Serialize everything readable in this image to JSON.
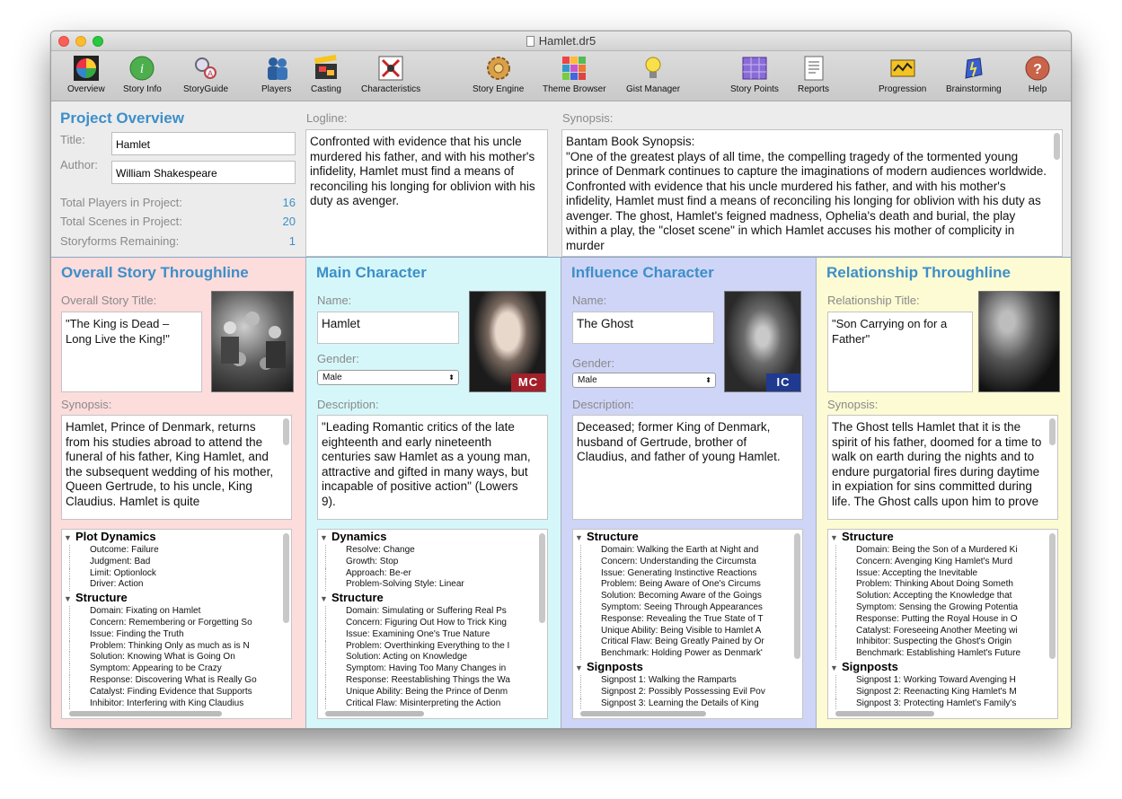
{
  "window": {
    "title": "Hamlet.dr5"
  },
  "toolbar": [
    {
      "label": "Overview",
      "icon": "overview-icon"
    },
    {
      "label": "Story Info",
      "icon": "story-info-icon"
    },
    {
      "label": "StoryGuide",
      "icon": "storyguide-icon"
    },
    {
      "label": "Players",
      "icon": "players-icon"
    },
    {
      "label": "Casting",
      "icon": "casting-icon"
    },
    {
      "label": "Characteristics",
      "icon": "characteristics-icon"
    },
    {
      "label": "Story Engine",
      "icon": "story-engine-icon"
    },
    {
      "label": "Theme Browser",
      "icon": "theme-browser-icon"
    },
    {
      "label": "Gist Manager",
      "icon": "gist-manager-icon"
    },
    {
      "label": "Story Points",
      "icon": "story-points-icon"
    },
    {
      "label": "Reports",
      "icon": "reports-icon"
    },
    {
      "label": "Progression",
      "icon": "progression-icon"
    },
    {
      "label": "Brainstorming",
      "icon": "brainstorming-icon"
    },
    {
      "label": "Help",
      "icon": "help-icon"
    }
  ],
  "overview": {
    "heading": "Project Overview",
    "title_label": "Title:",
    "title_value": "Hamlet",
    "author_label": "Author:",
    "author_value": "William Shakespeare",
    "stats": [
      {
        "label": "Total Players in Project:",
        "value": "16"
      },
      {
        "label": "Total Scenes in Project:",
        "value": "20"
      },
      {
        "label": "Storyforms Remaining:",
        "value": "1"
      }
    ],
    "logline_label": "Logline:",
    "logline": "Confronted with evidence that his uncle murdered his father, and with his mother's infidelity, Hamlet must find a means of reconciling his longing for oblivion with his duty as avenger.",
    "synopsis_label": "Synopsis:",
    "synopsis": "Bantam Book Synopsis:\n\"One of the greatest plays of all time, the compelling tragedy of the tormented young prince of Denmark continues to capture the imaginations of modern audiences worldwide. Confronted with evidence that his uncle murdered his father, and with his mother's infidelity, Hamlet must find a means of reconciling his longing for oblivion with his duty as avenger. The ghost, Hamlet's feigned madness, Ophelia's death and burial, the play within a play, the \"closet scene\" in which Hamlet accuses his mother of complicity in murder"
  },
  "panels": [
    {
      "heading": "Overall Story Throughline",
      "bg": "#fddcdc",
      "field_label": "Overall Story Title:",
      "field_value": "\"The King is Dead – Long Live the King!\"",
      "desc_label": "Synopsis:",
      "desc": "Hamlet, Prince of Denmark, returns from his studies abroad to attend the funeral of his father, King Hamlet, and the subsequent wedding of his mother, Queen Gertrude, to his uncle, King Claudius. Hamlet is quite",
      "tree": [
        {
          "head": "Plot Dynamics",
          "items": [
            "Outcome:  Failure",
            "Judgment:  Bad",
            "Limit:  Optionlock",
            "Driver:  Action"
          ]
        },
        {
          "head": "Structure",
          "items": [
            "Domain:  Fixating on Hamlet",
            "Concern:  Remembering or Forgetting So",
            "Issue:  Finding the Truth",
            "Problem:  Thinking Only as much as is N",
            "Solution:  Knowing What is Going On",
            "Symptom:  Appearing to be Crazy",
            "Response:  Discovering What is Really Go",
            "Catalyst:  Finding Evidence that Supports",
            "Inhibitor:  Interfering with King Claudius"
          ]
        }
      ]
    },
    {
      "heading": "Main Character",
      "bg": "#d6f7fa",
      "name_label": "Name:",
      "name_value": "Hamlet",
      "gender_label": "Gender:",
      "gender_value": "Male",
      "badge": "MC",
      "badge_color": "#a3202a",
      "desc_label": "Description:",
      "desc": "\"Leading Romantic critics of the late eighteenth and early nineteenth centuries saw Hamlet as a young man, attractive and gifted in many ways, but incapable of positive action\" (Lowers 9).",
      "tree": [
        {
          "head": "Dynamics",
          "items": [
            "Resolve:  Change",
            "Growth:  Stop",
            "Approach:  Be-er",
            "Problem-Solving Style:  Linear"
          ]
        },
        {
          "head": "Structure",
          "items": [
            "Domain:  Simulating or Suffering Real Ps",
            "Concern:  Figuring Out How to Trick King",
            "Issue:  Examining One's True Nature",
            "Problem:  Overthinking Everything to the I",
            "Solution:  Acting on Knowledge",
            "Symptom:  Having Too Many Changes in",
            "Response:  Reestablishing Things the Wa",
            "Unique Ability:  Being the Prince of Denm",
            "Critical Flaw:  Misinterpreting the Action"
          ]
        }
      ]
    },
    {
      "heading": "Influence Character",
      "bg": "#cfd5f7",
      "name_label": "Name:",
      "name_value": "The Ghost",
      "gender_label": "Gender:",
      "gender_value": "Male",
      "badge": "IC",
      "badge_color": "#1f3a8f",
      "desc_label": "Description:",
      "desc": "Deceased; former King of Denmark, husband of Gertrude, brother of Claudius, and father of young Hamlet.",
      "tree": [
        {
          "head": "Structure",
          "items": [
            "Domain:  Walking the Earth at Night and",
            "Concern:  Understanding the Circumsta",
            "Issue:  Generating Instinctive Reactions",
            "Problem:  Being Aware of One's Circums",
            "Solution:  Becoming Aware of the Goings",
            "Symptom:  Seeing Through Appearances",
            "Response:  Revealing the True State of T",
            "Unique Ability:  Being Visible to Hamlet A",
            "Critical Flaw:  Being Greatly Pained by Or",
            "Benchmark:  Holding Power as Denmark'"
          ]
        },
        {
          "head": "Signposts",
          "items": [
            "Signpost 1:  Walking the Ramparts",
            "Signpost 2:  Possibly Possessing Evil Pov",
            "Signpost 3:  Learning the Details of King"
          ]
        }
      ]
    },
    {
      "heading": "Relationship Throughline",
      "bg": "#fdfbd3",
      "field_label": "Relationship Title:",
      "field_value": "\"Son Carrying on for a Father\"",
      "desc_label": "Synopsis:",
      "desc": "The Ghost tells Hamlet that it is the spirit of his father, doomed for a time to walk on earth during the nights and to endure purgatorial fires during daytime in expiation for sins committed during life. The Ghost calls upon him to prove",
      "tree": [
        {
          "head": "Structure",
          "items": [
            "Domain:  Being the Son of a Murdered Ki",
            "Concern:  Avenging King Hamlet's Murd",
            "Issue:  Accepting the Inevitable",
            "Problem:  Thinking About Doing Someth",
            "Solution:  Accepting the Knowledge that",
            "Symptom:  Sensing the Growing Potentia",
            "Response:  Putting the Royal House in O",
            "Catalyst:  Foreseeing Another Meeting wi",
            "Inhibitor:  Suspecting the Ghost's Origin",
            "Benchmark:  Establishing Hamlet's Future"
          ]
        },
        {
          "head": "Signposts",
          "items": [
            "Signpost 1:  Working Toward Avenging H",
            "Signpost 2:  Reenacting King Hamlet's M",
            "Signpost 3:  Protecting Hamlet's Family's"
          ]
        }
      ]
    }
  ]
}
